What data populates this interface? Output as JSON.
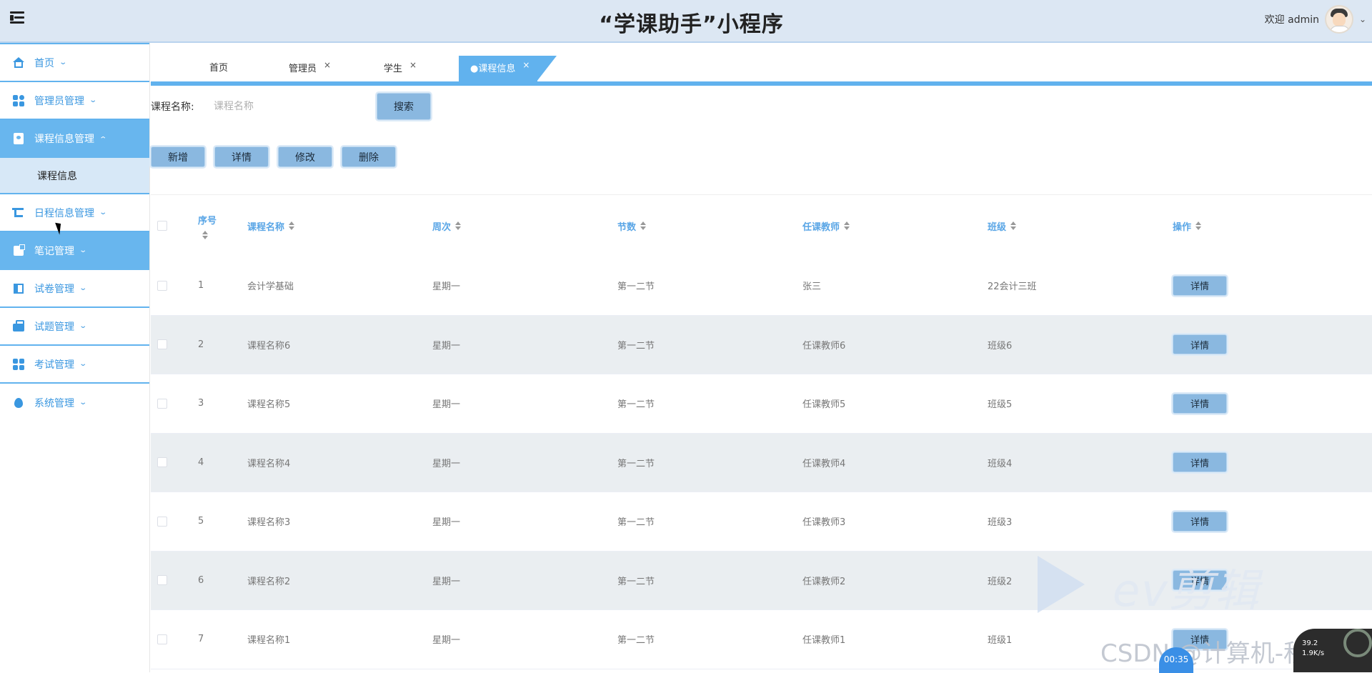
{
  "header": {
    "title": "“学课助手”小程序",
    "welcome": "欢迎 admin"
  },
  "sidebar": {
    "items": [
      {
        "label": "首页",
        "icon": "home-icon"
      },
      {
        "label": "管理员管理",
        "icon": "grid-icon"
      },
      {
        "label": "课程信息管理",
        "icon": "document-icon",
        "expanded": true,
        "active": true
      },
      {
        "label": "日程信息管理",
        "icon": "crop-icon"
      },
      {
        "label": "笔记管理",
        "icon": "note-icon",
        "active": true
      },
      {
        "label": "试卷管理",
        "icon": "book-icon"
      },
      {
        "label": "试题管理",
        "icon": "briefcase-icon"
      },
      {
        "label": "考试管理",
        "icon": "grid-icon"
      },
      {
        "label": "系统管理",
        "icon": "drop-icon"
      }
    ],
    "sub_items": {
      "course": "课程信息"
    }
  },
  "tabs": [
    {
      "label": "首页",
      "closable": false
    },
    {
      "label": "管理员",
      "closable": true
    },
    {
      "label": "学生",
      "closable": true
    },
    {
      "label": "●课程信息",
      "closable": true,
      "active": true
    }
  ],
  "tab_close_glyph": "×",
  "search": {
    "label": "课程名称:",
    "placeholder": "课程名称",
    "button": "搜索"
  },
  "actions": {
    "add": "新增",
    "detail": "详情",
    "edit": "修改",
    "delete": "删除"
  },
  "table": {
    "headers": {
      "seq": "序号",
      "name": "课程名称",
      "week": "周次",
      "section": "节数",
      "teacher": "任课教师",
      "class": "班级",
      "op": "操作"
    },
    "rows": [
      {
        "seq": "1",
        "name": "会计学基础",
        "week": "星期一",
        "section": "第一二节",
        "teacher": "张三",
        "class": "22会计三班",
        "op": "详情"
      },
      {
        "seq": "2",
        "name": "课程名称6",
        "week": "星期一",
        "section": "第一二节",
        "teacher": "任课教师6",
        "class": "班级6",
        "op": "详情"
      },
      {
        "seq": "3",
        "name": "课程名称5",
        "week": "星期一",
        "section": "第一二节",
        "teacher": "任课教师5",
        "class": "班级5",
        "op": "详情"
      },
      {
        "seq": "4",
        "name": "课程名称4",
        "week": "星期一",
        "section": "第一二节",
        "teacher": "任课教师4",
        "class": "班级4",
        "op": "详情"
      },
      {
        "seq": "5",
        "name": "课程名称3",
        "week": "星期一",
        "section": "第一二节",
        "teacher": "任课教师3",
        "class": "班级3",
        "op": "详情"
      },
      {
        "seq": "6",
        "name": "课程名称2",
        "week": "星期一",
        "section": "第一二节",
        "teacher": "任课教师2",
        "class": "班级2",
        "op": "详情"
      },
      {
        "seq": "7",
        "name": "课程名称1",
        "week": "星期一",
        "section": "第一二节",
        "teacher": "任课教师1",
        "class": "班级1",
        "op": "详情"
      }
    ]
  },
  "overlay": {
    "ev_text": "ev剪辑",
    "csdn": "CSDN @计算机-秋大田",
    "recorder_time": "00:35",
    "speed_up": "39.2",
    "speed_down": "1.9",
    "unit": "K/s"
  },
  "colors": {
    "accent": "#61b2ee",
    "button": "#8ab8e0",
    "header_bg": "#dce7f3"
  }
}
